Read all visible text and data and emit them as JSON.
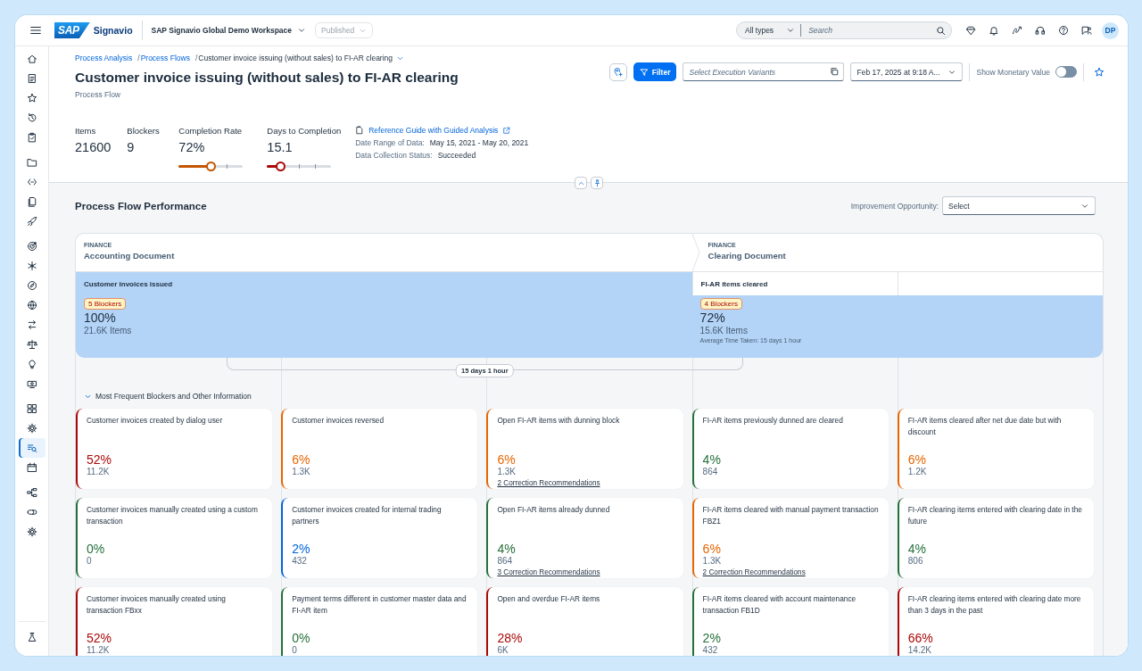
{
  "shell_bar": {
    "brand": "SAP",
    "product": "Signavio",
    "workspace": "SAP Signavio Global Demo Workspace",
    "status_select": {
      "value": "Published",
      "disabled": true
    },
    "search": {
      "scope": "All types",
      "placeholder": "Search"
    },
    "avatar": "DP"
  },
  "sidebar": {
    "groups": [
      {
        "items": [
          {
            "selected": false
          },
          {
            "selected": false
          },
          {
            "selected": false
          },
          {
            "selected": false
          },
          {
            "selected": false
          }
        ]
      },
      {
        "items": [
          {
            "selected": false
          },
          {
            "selected": false
          },
          {
            "selected": false
          },
          {
            "selected": false
          }
        ]
      },
      {
        "items": [
          {
            "selected": false
          },
          {
            "selected": false
          },
          {
            "selected": false
          },
          {
            "selected": false
          },
          {
            "selected": false
          },
          {
            "selected": false
          },
          {
            "selected": false
          },
          {
            "selected": false
          }
        ]
      },
      {
        "items": [
          {
            "selected": false
          },
          {
            "selected": false
          },
          {
            "selected": true
          },
          {
            "selected": false
          }
        ]
      },
      {
        "items": [
          {
            "selected": false
          },
          {
            "selected": false
          },
          {
            "selected": false
          }
        ]
      }
    ],
    "footer": [
      {
        "selected": false
      }
    ]
  },
  "breadcrumb": [
    {
      "label": "Process Analysis",
      "kind": "link",
      "separator": "/"
    },
    {
      "label": "Process Flows",
      "kind": "link",
      "separator": "/"
    },
    {
      "label": "Customer invoice issuing (without sales) to FI-AR clearing",
      "kind": "current"
    }
  ],
  "title": "Customer invoice issuing (without sales) to FI-AR clearing",
  "subtitle": "Process Flow",
  "toolbar": {
    "filter_label": "Filter",
    "variants_placeholder": "Select Execution Variants",
    "date_value": "Feb 17, 2025 at 9:18 A...",
    "monetary_toggle": {
      "label": "Show Monetary Value",
      "on": false
    }
  },
  "kpis": [
    {
      "kind": "plain",
      "label": "Items",
      "value": "21600"
    },
    {
      "kind": "plain",
      "label": "Blockers",
      "value": "9"
    },
    {
      "kind": "slider",
      "label": "Completion Rate",
      "value": "72%",
      "level": 0.49,
      "color": "#c35500"
    },
    {
      "kind": "slider",
      "label": "Days to Completion",
      "value": "15.1",
      "level": 0.2,
      "color": "#aa0808"
    }
  ],
  "reference": {
    "link": "Reference Guide with Guided Analysis",
    "fields": [
      {
        "label": "Date Range of Data:",
        "value": "May 15, 2021 - May 20, 2021"
      },
      {
        "label": "Data Collection Status:",
        "value": "Succeeded"
      }
    ]
  },
  "performance": {
    "title": "Process Flow Performance",
    "improvement": {
      "label": "Improvement Opportunity:",
      "value": "Select"
    },
    "objects": [
      {
        "category": "FINANCE",
        "name": "Accounting Document",
        "steps": [
          {
            "kind": "summary",
            "label": "Customer invoices issued",
            "blockers": "5 Blockers",
            "share": "100%",
            "items": "21.6K Items"
          }
        ]
      },
      {
        "category": "FINANCE",
        "name": "Clearing Document",
        "steps": [
          {
            "kind": "step",
            "label": "FI-AR items cleared",
            "blockers": "4 Blockers",
            "share": "72%",
            "items": "15.6K Items",
            "average_time": "Average Time Taken: 15 days 1 hour"
          },
          {
            "kind": "empty"
          }
        ]
      }
    ],
    "duration": "15 days 1 hour",
    "blockers_toggle": {
      "label": "Most Frequent Blockers and Other Information",
      "expanded": true
    },
    "blocker_cards": [
      {
        "title": "Customer invoices created by dialog user",
        "share": "52%",
        "count": "11.2K",
        "color": "#aa0808"
      },
      {
        "title": "Customer invoices reversed",
        "share": "6%",
        "count": "1.3K",
        "color": "#e76500"
      },
      {
        "title": "Open FI-AR items with dunning block",
        "share": "6%",
        "count": "1.3K",
        "color": "#e76500",
        "link": "2 Correction Recommendations"
      },
      {
        "title": "FI-AR items previously dunned are cleared",
        "share": "4%",
        "count": "864",
        "color": "#256f3a"
      },
      {
        "title": "FI-AR items cleared after net due date but with discount",
        "share": "6%",
        "count": "1.2K",
        "color": "#e76500"
      },
      {
        "title": "Customer invoices manually created using a custom transaction",
        "share": "0%",
        "count": "0",
        "color": "#256f3a"
      },
      {
        "title": "Customer invoices created for internal trading partners",
        "share": "2%",
        "count": "432",
        "color": "#0064d9"
      },
      {
        "title": "Open FI-AR items already dunned",
        "share": "4%",
        "count": "864",
        "color": "#256f3a",
        "link": "3 Correction Recommendations"
      },
      {
        "title": "FI-AR items cleared with manual payment transaction FBZ1",
        "share": "6%",
        "count": "1.3K",
        "color": "#e76500",
        "link": "2 Correction Recommendations"
      },
      {
        "title": "FI-AR clearing items entered with clearing date in the future",
        "share": "4%",
        "count": "806",
        "color": "#256f3a"
      },
      {
        "title": "Customer invoices manually created using transaction FBxx",
        "share": "52%",
        "count": "11.2K",
        "color": "#aa0808"
      },
      {
        "title": "Payment terms different in customer master data and FI-AR item",
        "share": "0%",
        "count": "0",
        "color": "#256f3a"
      },
      {
        "title": "Open and overdue FI-AR items",
        "share": "28%",
        "count": "6K",
        "color": "#aa0808"
      },
      {
        "title": "FI-AR items cleared with account maintenance transaction FB1D",
        "share": "2%",
        "count": "432",
        "color": "#256f3a"
      },
      {
        "title": "FI-AR clearing items entered with clearing date more than 3 days in the past",
        "share": "66%",
        "count": "14.2K",
        "color": "#aa0808"
      }
    ]
  }
}
